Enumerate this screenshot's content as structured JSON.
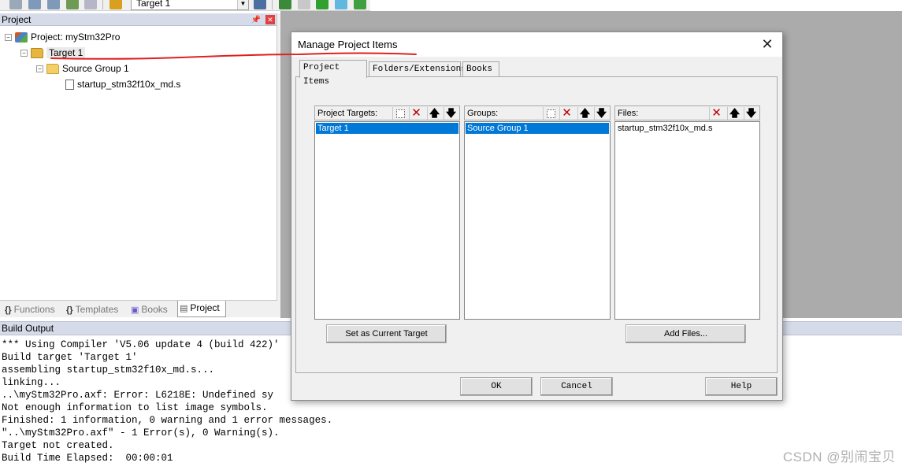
{
  "toolbar": {
    "target_value": "Target 1"
  },
  "project_panel": {
    "title": "Project",
    "tree": {
      "project_label": "Project: myStm32Pro",
      "target_label": "Target 1",
      "group_label": "Source Group 1",
      "file_label": "startup_stm32f10x_md.s"
    },
    "tabs": [
      {
        "label": "Functions",
        "icon": "{}"
      },
      {
        "label": "Templates",
        "icon": "{}"
      },
      {
        "label": "Books",
        "icon": "book-icon"
      },
      {
        "label": "Project",
        "icon": "project-icon"
      }
    ]
  },
  "build_output": {
    "title": "Build Output",
    "lines": [
      "*** Using Compiler 'V5.06 update 4 (build 422)'",
      "Build target 'Target 1'",
      "assembling startup_stm32f10x_md.s...",
      "linking...",
      "..\\myStm32Pro.axf: Error: L6218E: Undefined sy",
      "Not enough information to list image symbols.",
      "Finished: 1 information, 0 warning and 1 error messages.",
      "\"..\\myStm32Pro.axf\" - 1 Error(s), 0 Warning(s).",
      "Target not created.",
      "Build Time Elapsed:  00:00:01"
    ]
  },
  "dialog": {
    "title": "Manage Project Items",
    "close_glyph": "✕",
    "tabs": [
      "Project Items",
      "Folders/Extensions",
      "Books"
    ],
    "targets": {
      "header": "Project Targets:",
      "items": [
        "Target 1"
      ]
    },
    "groups": {
      "header": "Groups:",
      "items": [
        "Source Group 1"
      ]
    },
    "files": {
      "header": "Files:",
      "items": [
        "startup_stm32f10x_md.s"
      ]
    },
    "set_current_button": "Set as Current Target",
    "add_files_button": "Add Files...",
    "ok_button": "OK",
    "cancel_button": "Cancel",
    "help_button": "Help"
  },
  "watermark": "CSDN @别闹宝贝",
  "colors": {
    "selection": "#0078d7",
    "annotation": "#e02020",
    "panel_title": "#d6dbe9",
    "workspace": "#ababab"
  }
}
